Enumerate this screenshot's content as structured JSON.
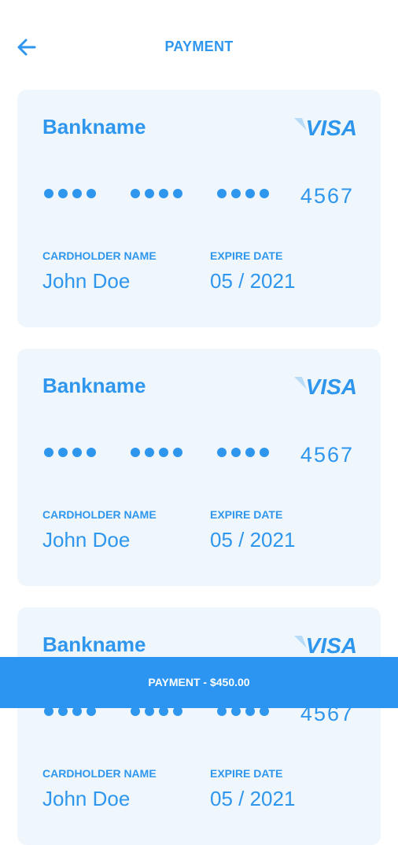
{
  "header": {
    "title": "PAYMENT",
    "back_icon": "arrow-left-icon"
  },
  "cards": [
    {
      "bank": "Bankname",
      "brand": "VISA",
      "last4": "4567",
      "holder_label": "CARDHOLDER NAME",
      "holder": "John Doe",
      "expiry_label": "EXPIRE DATE",
      "expiry": "05 / 2021"
    },
    {
      "bank": "Bankname",
      "brand": "VISA",
      "last4": "4567",
      "holder_label": "CARDHOLDER NAME",
      "holder": "John Doe",
      "expiry_label": "EXPIRE DATE",
      "expiry": "05 / 2021"
    },
    {
      "bank": "Bankname",
      "brand": "VISA",
      "last4": "4567",
      "holder_label": "CARDHOLDER NAME",
      "holder": "John Doe",
      "expiry_label": "EXPIRE DATE",
      "expiry": "05 / 2021"
    }
  ],
  "pay_button": {
    "label": "PAYMENT - $450.00"
  },
  "colors": {
    "accent": "#2f96ee",
    "card_bg": "#eff7fd",
    "button_bg": "#2b95f1"
  }
}
